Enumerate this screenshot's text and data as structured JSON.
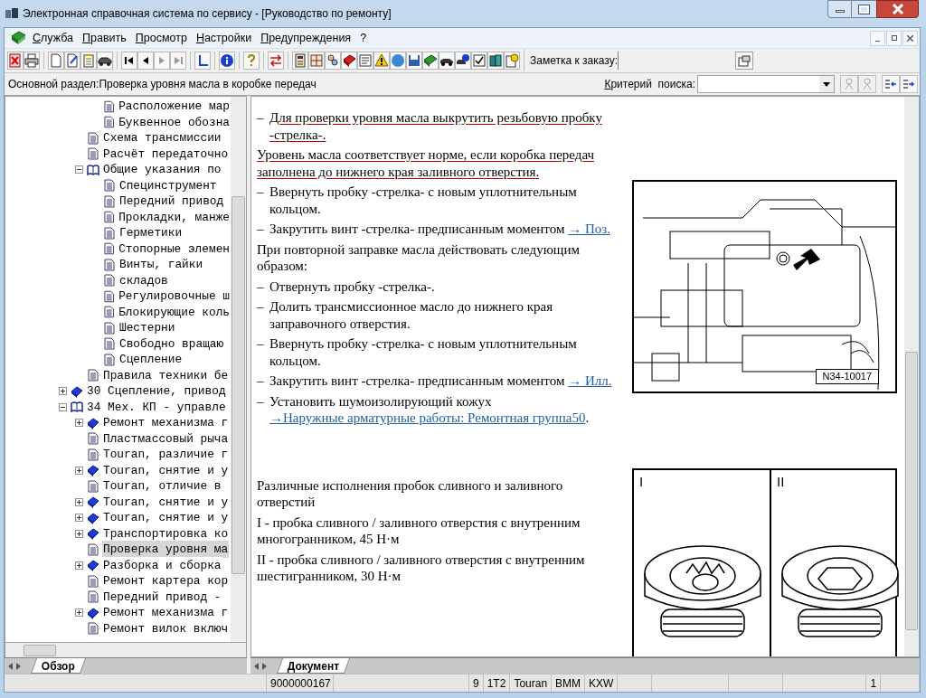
{
  "window": {
    "title": "Электронная справочная система по сервису - [Руководство по ремонту]"
  },
  "menu": [
    {
      "label": "Служба"
    },
    {
      "label": "Править"
    },
    {
      "label": "Просмотр"
    },
    {
      "label": "Настройки"
    },
    {
      "label": "Предупреждения"
    },
    {
      "label": "?"
    }
  ],
  "toolbar": {
    "note_label": "Заметка к заказу:"
  },
  "info_bar": {
    "breadcrumb": "Основной раздел:Проверка уровня масла в коробке передач",
    "search_label": "Критерий  поиска:"
  },
  "tree": [
    {
      "children": [
        {
          "children": [
            {
              "label": "Расположение мар",
              "kind": "page",
              "selected": false
            },
            {
              "label": "Буквенное обозна",
              "kind": "page",
              "selected": false
            }
          ]
        },
        {
          "label": "Схема трансмиссии",
          "kind": "page",
          "selected": false
        },
        {
          "label": "Расчёт передаточно",
          "kind": "page",
          "selected": false
        },
        {
          "label": "Общие указания по",
          "kind": "open_book",
          "expanded": true,
          "selected": false,
          "children": [
            {
              "label": "Специнструмент",
              "kind": "page",
              "selected": false
            },
            {
              "label": "Передний привод",
              "kind": "page",
              "selected": false
            },
            {
              "label": "Прокладки, манже",
              "kind": "page",
              "selected": false
            },
            {
              "label": "Герметики",
              "kind": "page",
              "selected": false
            },
            {
              "label": "Стопорные элемен",
              "kind": "page",
              "selected": false
            },
            {
              "label": "Винты, гайки",
              "kind": "page",
              "selected": false
            },
            {
              "label": "складов",
              "kind": "page",
              "selected": false
            },
            {
              "label": "Регулировочные ш",
              "kind": "page",
              "selected": false
            },
            {
              "label": "Блокирующие коль",
              "kind": "page",
              "selected": false
            },
            {
              "label": "Шестерни",
              "kind": "page",
              "selected": false
            },
            {
              "label": "Свободно вращаю",
              "kind": "page",
              "selected": false
            },
            {
              "label": "Сцепление",
              "kind": "page",
              "selected": false
            }
          ]
        },
        {
          "label": "Правила техники бе",
          "kind": "page",
          "selected": false
        }
      ]
    },
    {
      "label": "30 Сцепление, привод",
      "kind": "book",
      "expanded": false,
      "selected": false
    },
    {
      "label": "34 Мех. КП - управле",
      "kind": "open_book",
      "expanded": true,
      "selected": false,
      "children": [
        {
          "label": "Ремонт механизма г",
          "kind": "book",
          "expanded": false,
          "selected": false
        },
        {
          "label": "Пластмассовый рыча",
          "kind": "page",
          "selected": false
        },
        {
          "label": "Touran, различие г",
          "kind": "page",
          "selected": false
        },
        {
          "label": "Touran, снятие и у",
          "kind": "book",
          "expanded": false,
          "selected": false
        },
        {
          "label": "Touran, отличие в",
          "kind": "page",
          "selected": false
        },
        {
          "label": "Touran, снятие и у",
          "kind": "book",
          "expanded": false,
          "selected": false
        },
        {
          "label": "Touran, снятие и у",
          "kind": "book",
          "expanded": false,
          "selected": false
        },
        {
          "label": "Транспортировка ко",
          "kind": "book",
          "expanded": false,
          "selected": false
        },
        {
          "label": "Проверка уровня ма",
          "kind": "page",
          "selected": true
        },
        {
          "label": "Разборка и сборка",
          "kind": "book",
          "expanded": false,
          "selected": false
        },
        {
          "label": "Ремонт картера кор",
          "kind": "page",
          "selected": false
        },
        {
          "label": "Передний привод -",
          "kind": "page",
          "selected": false
        },
        {
          "label": "Ремонт механизма г",
          "kind": "book",
          "expanded": false,
          "selected": false
        },
        {
          "label": "Ремонт вилок включ",
          "kind": "page",
          "selected": false
        }
      ]
    }
  ],
  "left_tabs": [
    {
      "label": "Обзор",
      "selected": true
    }
  ],
  "document": {
    "sections": [
      {
        "paragraphs": [
          {
            "kind": "step",
            "bullet": "–",
            "text": "Для проверки уровня масла выкрутить резьбовую пробку -стрелка-.",
            "highlighted": true
          },
          {
            "kind": "note",
            "text": "Уровень масла соответствует норме, если коробка передач заполнена до нижнего края заливного отверстия.",
            "highlighted": true
          },
          {
            "kind": "step",
            "bullet": "–",
            "text": "Ввернуть пробку -стрелка- с новым уплотнительным кольцом.",
            "highlighted": false
          },
          {
            "kind": "step",
            "bullet": "–",
            "text": "Закрутить винт -стрелка- предписанным моментом",
            "link": "→ Поз.",
            "highlighted": false
          },
          {
            "kind": "note",
            "text": "При повторной заправке масла действовать следующим образом:",
            "highlighted": false
          },
          {
            "kind": "step",
            "bullet": "–",
            "text": "Отвернуть пробку -стрелка-.",
            "highlighted": false
          },
          {
            "kind": "step",
            "bullet": "–",
            "text": "Долить трансмиссионное масло до нижнего края заправочного отверстия.",
            "highlighted": false
          },
          {
            "kind": "step",
            "bullet": "–",
            "text": "Ввернуть пробку -стрелка- с новым уплотнительным кольцом.",
            "highlighted": false
          },
          {
            "kind": "step",
            "bullet": "–",
            "text": "Закрутить винт -стрелка- предписанным моментом",
            "link": "→ Илл.",
            "highlighted": false
          },
          {
            "kind": "step",
            "bullet": "–",
            "text": "Установить шумоизолирующий кожух",
            "link": "→Наружные арматурные работы: Ремонтная группа50",
            "after": ".",
            "highlighted": false
          }
        ]
      },
      {
        "paragraphs": [
          {
            "kind": "note",
            "text": "Различные исполнения пробок сливного и заливного отверстий",
            "highlighted": false
          },
          {
            "kind": "note",
            "text": "I - пробка сливного / заливного отверстия с внутренним многогранником, 45 Н·м",
            "highlighted": false
          },
          {
            "kind": "note",
            "text": "II - пробка сливного / заливного отверстия с внутренним шестигранником, 30 Н·м",
            "highlighted": false
          }
        ]
      }
    ],
    "figures": [
      {
        "kind": "gearbox",
        "code": "N34-10017"
      },
      {
        "kind": "plugs",
        "panels": [
          "I",
          "II"
        ]
      }
    ]
  },
  "doc_tabs": [
    {
      "label": "Документ",
      "selected": true
    }
  ],
  "status_bar": {
    "order": "9000000167",
    "fields": [
      "9",
      "1T2",
      "Touran",
      "BMM",
      "KXW"
    ],
    "page": "1"
  }
}
